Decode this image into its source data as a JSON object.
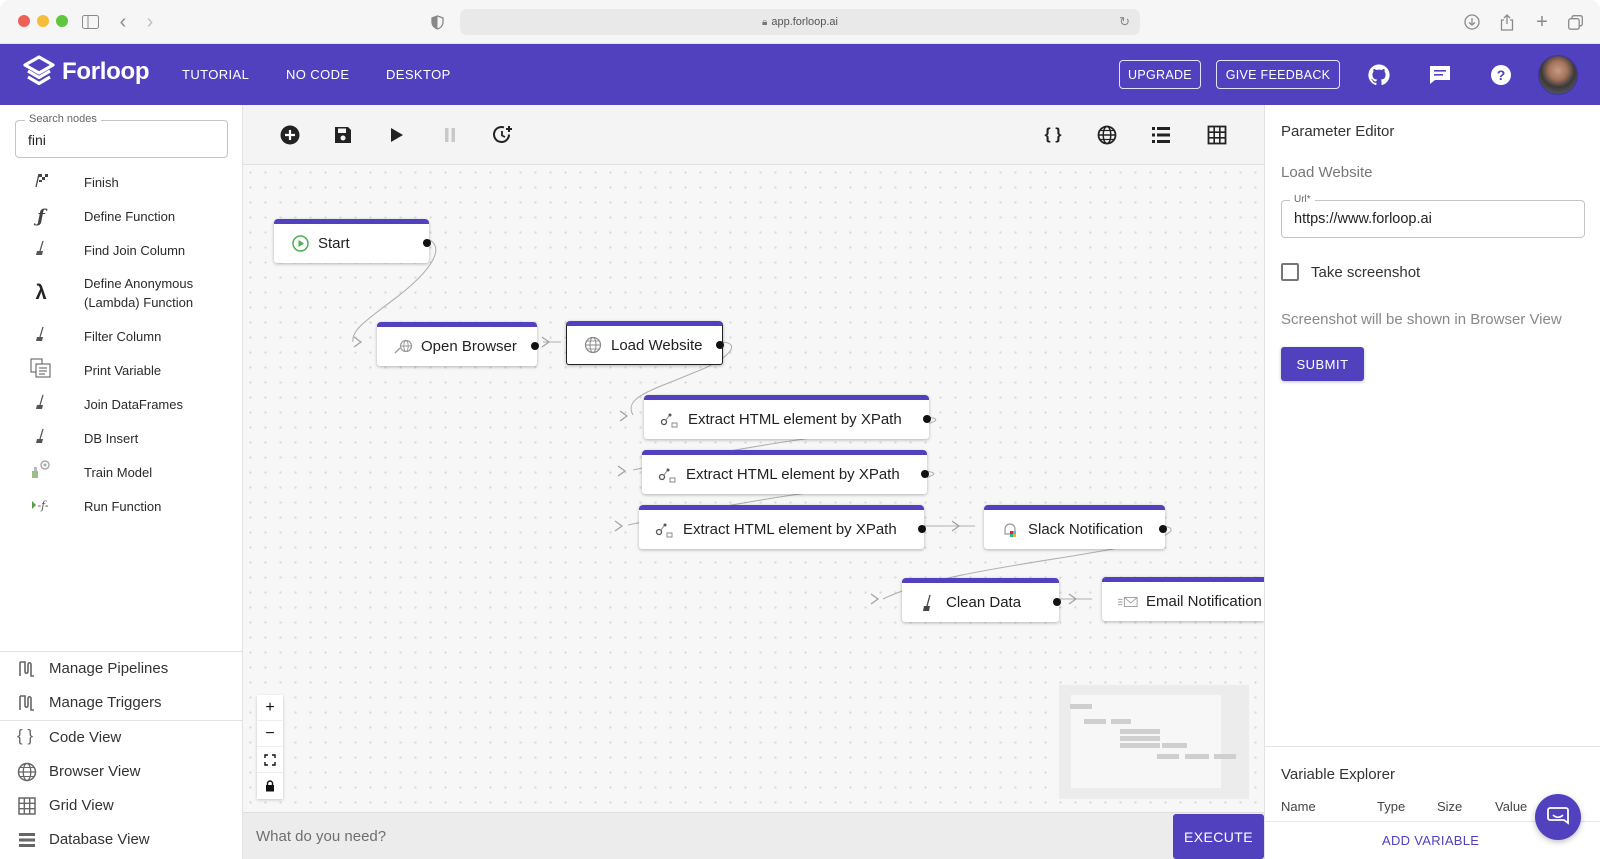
{
  "browser": {
    "url": "app.forloop.ai"
  },
  "header": {
    "logo_text": "Forloop",
    "nav": [
      "TUTORIAL",
      "NO CODE",
      "DESKTOP"
    ],
    "upgrade_label": "UPGRADE",
    "feedback_label": "GIVE FEEDBACK"
  },
  "sidebar": {
    "search_legend": "Search nodes",
    "search_value": "fini",
    "nodes": [
      {
        "label": "Finish",
        "icon": "checkered-flag-icon"
      },
      {
        "label": "Define Function",
        "icon": "function-icon"
      },
      {
        "label": "Find Join Column",
        "icon": "broom-icon"
      },
      {
        "label": "Define Anonymous",
        "label2": "(Lambda) Function",
        "icon": "lambda-icon"
      },
      {
        "label": "Filter Column",
        "icon": "broom-icon"
      },
      {
        "label": "Print Variable",
        "icon": "print-icon"
      },
      {
        "label": "Join DataFrames",
        "icon": "broom-icon"
      },
      {
        "label": "DB Insert",
        "icon": "broom-icon"
      },
      {
        "label": "Train Model",
        "icon": "model-icon"
      },
      {
        "label": "Run Function",
        "icon": "run-function-icon"
      }
    ],
    "links": [
      {
        "label": "Manage Pipelines",
        "icon": "pipeline-icon"
      },
      {
        "label": "Manage Triggers",
        "icon": "trigger-icon"
      },
      {
        "label": "Code View",
        "icon": "code-braces-icon"
      },
      {
        "label": "Browser View",
        "icon": "globe-icon"
      },
      {
        "label": "Grid View",
        "icon": "grid-icon"
      },
      {
        "label": "Database View",
        "icon": "database-icon"
      }
    ]
  },
  "canvas": {
    "nodes": {
      "start": "Start",
      "open_browser": "Open Browser",
      "load_website": "Load Website",
      "extract_1": "Extract HTML element by XPath",
      "extract_2": "Extract HTML element by XPath",
      "extract_3": "Extract HTML element by XPath",
      "slack": "Slack Notification",
      "clean": "Clean Data",
      "email": "Email Notification"
    }
  },
  "prompt": {
    "placeholder": "What do you need?",
    "execute_label": "EXECUTE"
  },
  "param_editor": {
    "title": "Parameter Editor",
    "node_name": "Load Website",
    "url_legend": "Url*",
    "url_value": "https://www.forloop.ai",
    "screenshot_label": "Take screenshot",
    "screenshot_checked": false,
    "hint": "Screenshot will be shown in Browser View",
    "submit_label": "SUBMIT"
  },
  "variable_explorer": {
    "title": "Variable Explorer",
    "columns": [
      "Name",
      "Type",
      "Size",
      "Value"
    ],
    "add_label": "ADD VARIABLE"
  },
  "colors": {
    "brand": "#5141bf"
  }
}
